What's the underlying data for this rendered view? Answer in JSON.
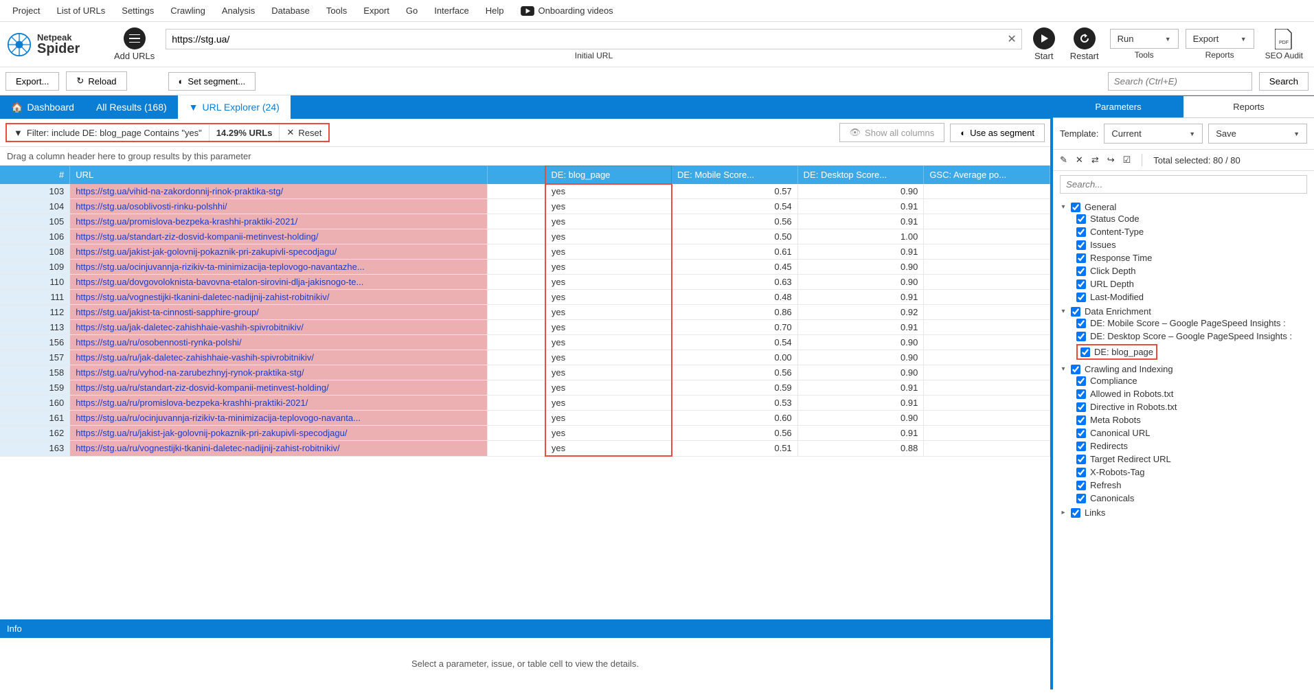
{
  "menu": [
    "Project",
    "List of URLs",
    "Settings",
    "Crawling",
    "Analysis",
    "Database",
    "Tools",
    "Export",
    "Go",
    "Interface",
    "Help"
  ],
  "onboarding": "Onboarding videos",
  "logo": {
    "t1": "Netpeak",
    "t2": "Spider"
  },
  "toolbar": {
    "add_urls": "Add URLs",
    "url_value": "https://stg.ua/",
    "url_label": "Initial URL",
    "start": "Start",
    "restart": "Restart",
    "run": "Run",
    "tools": "Tools",
    "export": "Export",
    "reports": "Reports",
    "seo": "SEO Audit"
  },
  "secondbar": {
    "export": "Export...",
    "reload": "Reload",
    "set_segment": "Set segment...",
    "search_ph": "Search (Ctrl+E)",
    "search_btn": "Search"
  },
  "lefttabs": {
    "dashboard": "Dashboard",
    "all_results": "All Results (168)",
    "url_explorer": "URL Explorer (24)"
  },
  "filter": {
    "text": "Filter: include DE: blog_page Contains \"yes\"",
    "pct": "14.29% URLs",
    "reset": "Reset",
    "show_all": "Show all columns",
    "use_segment": "Use as segment"
  },
  "grouphint": "Drag a column header here to group results by this parameter",
  "cols": {
    "num": "#",
    "url": "URL",
    "de_blog": "DE: blog_page",
    "de_mobile": "DE: Mobile Score...",
    "de_desktop": "DE: Desktop Score...",
    "gsc": "GSC: Average po..."
  },
  "rows": [
    {
      "n": 103,
      "url": "https://stg.ua/vihid-na-zakordonnij-rinok-praktika-stg/",
      "de": "yes",
      "m": "0.57",
      "d": "0.90"
    },
    {
      "n": 104,
      "url": "https://stg.ua/osoblivosti-rinku-polshhi/",
      "de": "yes",
      "m": "0.54",
      "d": "0.91"
    },
    {
      "n": 105,
      "url": "https://stg.ua/promislova-bezpeka-krashhi-praktiki-2021/",
      "de": "yes",
      "m": "0.56",
      "d": "0.91"
    },
    {
      "n": 106,
      "url": "https://stg.ua/standart-ziz-dosvid-kompanii-metinvest-holding/",
      "de": "yes",
      "m": "0.50",
      "d": "1.00"
    },
    {
      "n": 108,
      "url": "https://stg.ua/jakist-jak-golovnij-pokaznik-pri-zakupivli-specodjagu/",
      "de": "yes",
      "m": "0.61",
      "d": "0.91"
    },
    {
      "n": 109,
      "url": "https://stg.ua/ocinjuvannja-rizikiv-ta-minimizacija-teplovogo-navantazhe...",
      "de": "yes",
      "m": "0.45",
      "d": "0.90"
    },
    {
      "n": 110,
      "url": "https://stg.ua/dovgovoloknista-bavovna-etalon-sirovini-dlja-jakisnogo-te...",
      "de": "yes",
      "m": "0.63",
      "d": "0.90"
    },
    {
      "n": 111,
      "url": "https://stg.ua/vognestijki-tkanini-daletec-nadijnij-zahist-robitnikiv/",
      "de": "yes",
      "m": "0.48",
      "d": "0.91"
    },
    {
      "n": 112,
      "url": "https://stg.ua/jakist-ta-cinnosti-sapphire-group/",
      "de": "yes",
      "m": "0.86",
      "d": "0.92"
    },
    {
      "n": 113,
      "url": "https://stg.ua/jak-daletec-zahishhaie-vashih-spivrobitnikiv/",
      "de": "yes",
      "m": "0.70",
      "d": "0.91"
    },
    {
      "n": 156,
      "url": "https://stg.ua/ru/osobennosti-rynka-polshi/",
      "de": "yes",
      "m": "0.54",
      "d": "0.90"
    },
    {
      "n": 157,
      "url": "https://stg.ua/ru/jak-daletec-zahishhaie-vashih-spivrobitnikiv/",
      "de": "yes",
      "m": "0.00",
      "d": "0.90"
    },
    {
      "n": 158,
      "url": "https://stg.ua/ru/vyhod-na-zarubezhnyj-rynok-praktika-stg/",
      "de": "yes",
      "m": "0.56",
      "d": "0.90"
    },
    {
      "n": 159,
      "url": "https://stg.ua/ru/standart-ziz-dosvid-kompanii-metinvest-holding/",
      "de": "yes",
      "m": "0.59",
      "d": "0.91"
    },
    {
      "n": 160,
      "url": "https://stg.ua/ru/promislova-bezpeka-krashhi-praktiki-2021/",
      "de": "yes",
      "m": "0.53",
      "d": "0.91"
    },
    {
      "n": 161,
      "url": "https://stg.ua/ru/ocinjuvannja-rizikiv-ta-minimizacija-teplovogo-navanta...",
      "de": "yes",
      "m": "0.60",
      "d": "0.90"
    },
    {
      "n": 162,
      "url": "https://stg.ua/ru/jakist-jak-golovnij-pokaznik-pri-zakupivli-specodjagu/",
      "de": "yes",
      "m": "0.56",
      "d": "0.91"
    },
    {
      "n": 163,
      "url": "https://stg.ua/ru/vognestijki-tkanini-daletec-nadijnij-zahist-robitnikiv/",
      "de": "yes",
      "m": "0.51",
      "d": "0.88"
    }
  ],
  "info_title": "Info",
  "infohint": "Select a parameter, issue, or table cell to view the details.",
  "right": {
    "tabs": {
      "params": "Parameters",
      "reports": "Reports"
    },
    "template_label": "Template:",
    "template_value": "Current",
    "save": "Save",
    "total": "Total selected: 80 / 80",
    "search_ph": "Search...",
    "tree": {
      "general": {
        "label": "General",
        "items": [
          "Status Code",
          "Content-Type",
          "Issues",
          "Response Time",
          "Click Depth",
          "URL Depth",
          "Last-Modified"
        ]
      },
      "data_enrich": {
        "label": "Data Enrichment",
        "items": [
          "DE: Mobile Score  –  Google PageSpeed Insights  :",
          "DE: Desktop Score  –  Google PageSpeed Insights  :",
          "DE: blog_page"
        ]
      },
      "crawl": {
        "label": "Crawling and Indexing",
        "items": [
          "Compliance",
          "Allowed in Robots.txt",
          "Directive in Robots.txt",
          "Meta Robots",
          "Canonical URL",
          "Redirects",
          "Target Redirect URL",
          "X-Robots-Tag",
          "Refresh",
          "Canonicals"
        ]
      },
      "links": {
        "label": "Links"
      }
    }
  }
}
